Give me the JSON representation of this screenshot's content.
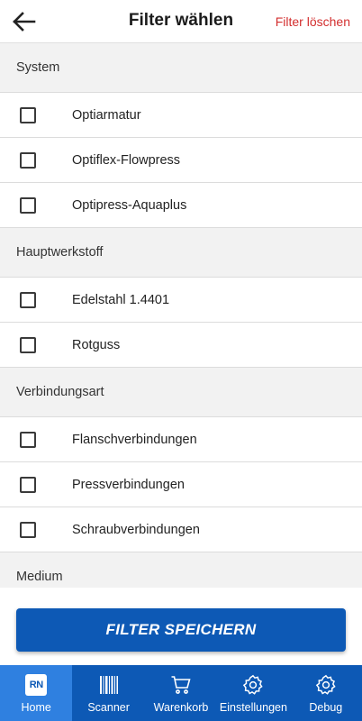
{
  "header": {
    "title": "Filter wählen",
    "clear_label": "Filter löschen"
  },
  "sections": [
    {
      "title": "System",
      "items": [
        "Optiarmatur",
        "Optiflex-Flowpress",
        "Optipress-Aquaplus"
      ]
    },
    {
      "title": "Hauptwerkstoff",
      "items": [
        "Edelstahl 1.4401",
        "Rotguss"
      ]
    },
    {
      "title": "Verbindungsart",
      "items": [
        "Flanschverbindungen",
        "Pressverbindungen",
        "Schraubverbindungen"
      ]
    },
    {
      "title": "Medium",
      "items": []
    }
  ],
  "save_button": {
    "label": "FILTER SPEICHERN"
  },
  "nav": {
    "items": [
      {
        "label": "Home",
        "icon": "rn-logo-icon",
        "logo_text": "RN",
        "active": true
      },
      {
        "label": "Scanner",
        "icon": "barcode-icon"
      },
      {
        "label": "Warenkorb",
        "icon": "cart-icon"
      },
      {
        "label": "Einstellungen",
        "icon": "gear-icon"
      },
      {
        "label": "Debug",
        "icon": "gear-icon"
      }
    ]
  },
  "colors": {
    "primary": "#0d59b5",
    "nav_active": "#2f80e0",
    "danger_text": "#d32f2f",
    "section_bg": "#f2f2f2"
  }
}
